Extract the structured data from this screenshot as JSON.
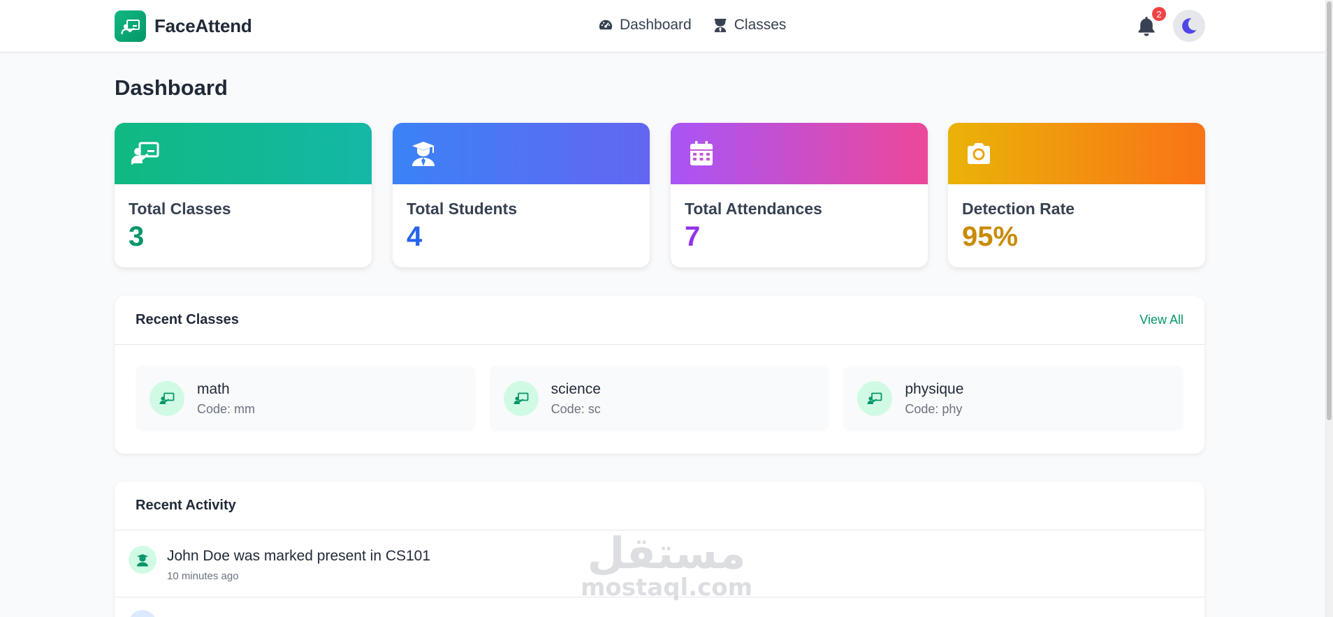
{
  "header": {
    "brand": "FaceAttend",
    "nav": [
      {
        "label": "Dashboard",
        "icon": "gauge-icon"
      },
      {
        "label": "Classes",
        "icon": "graduate-icon"
      }
    ],
    "notification_count": "2",
    "theme_icon": "moon-icon"
  },
  "page": {
    "title": "Dashboard"
  },
  "stats": [
    {
      "label": "Total Classes",
      "value": "3",
      "icon": "chalkboard-teacher-icon",
      "color": "#059669"
    },
    {
      "label": "Total Students",
      "value": "4",
      "icon": "graduate-icon",
      "color": "#2563eb"
    },
    {
      "label": "Total Attendances",
      "value": "7",
      "icon": "calendar-icon",
      "color": "#9333ea"
    },
    {
      "label": "Detection Rate",
      "value": "95%",
      "icon": "camera-icon",
      "color": "#ca8a04"
    }
  ],
  "recent_classes": {
    "title": "Recent Classes",
    "view_all": "View All",
    "items": [
      {
        "name": "math",
        "code": "Code: mm"
      },
      {
        "name": "science",
        "code": "Code: sc"
      },
      {
        "name": "physique",
        "code": "Code: phy"
      }
    ]
  },
  "recent_activity": {
    "title": "Recent Activity",
    "items": [
      {
        "text": "John Doe was marked present in CS101",
        "time": "10 minutes ago"
      }
    ]
  },
  "watermark": {
    "arabic": "مستقل",
    "latin": "mostaql.com"
  },
  "colors": {
    "accent": "#059669",
    "badge": "#ef4444",
    "moon": "#4f46e5"
  }
}
